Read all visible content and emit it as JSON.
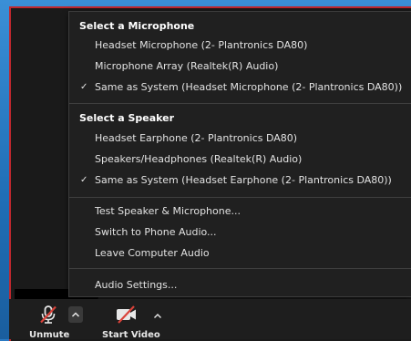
{
  "menu": {
    "mic_title": "Select a Microphone",
    "mic_items": [
      {
        "label": "Headset Microphone (2- Plantronics DA80)",
        "checked": false
      },
      {
        "label": "Microphone Array (Realtek(R) Audio)",
        "checked": false
      },
      {
        "label": "Same as System (Headset Microphone (2- Plantronics DA80))",
        "checked": true
      }
    ],
    "speaker_title": "Select a Speaker",
    "speaker_items": [
      {
        "label": "Headset Earphone (2- Plantronics DA80)",
        "checked": false
      },
      {
        "label": "Speakers/Headphones (Realtek(R) Audio)",
        "checked": false
      },
      {
        "label": "Same as System (Headset Earphone (2- Plantronics DA80))",
        "checked": true
      }
    ],
    "actions": [
      {
        "label": "Test Speaker & Microphone..."
      },
      {
        "label": "Switch to Phone Audio..."
      },
      {
        "label": "Leave Computer Audio"
      }
    ],
    "settings": {
      "label": "Audio Settings..."
    },
    "check_glyph": "✓"
  },
  "toolbar": {
    "unmute_label": "Unmute",
    "start_video_label": "Start Video",
    "mic_icon": "microphone-muted-icon",
    "video_icon": "video-camera-off-icon",
    "caret_icon": "chevron-up-icon"
  },
  "colors": {
    "menu_bg": "#202020",
    "accent_red": "#c0272d",
    "mute_slash": "#d9423a"
  }
}
